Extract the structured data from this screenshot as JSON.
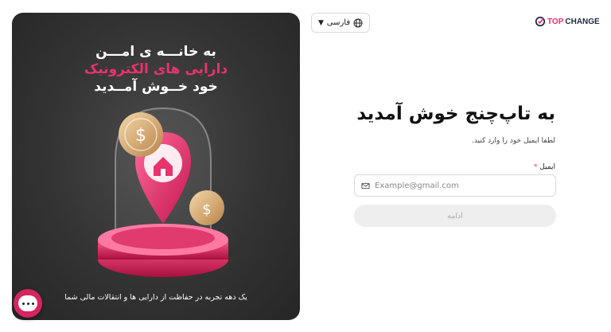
{
  "brand": {
    "logo_top": "TOP",
    "logo_change": "CHANGE",
    "accent_color": "#e8336d",
    "dark_color": "#1f2a44"
  },
  "language_selector": {
    "label": "فارسی",
    "icon": "globe-icon",
    "chevron": "chevron-down-icon"
  },
  "promo": {
    "line1": "به خانـــه ی امـــن",
    "line2": "دارایی های الکترونیک",
    "line3": "خود خــوش آمــدید",
    "caption": "یک دهه تجربه در حفاظت از دارایی ها و انتقالات مالی شما"
  },
  "form": {
    "title": "به تاپ‌چنج خوش آمدید",
    "subtitle": "لطفا ایمیل خود را وارد کنید.",
    "email_label": "ایمیل",
    "required_mark": "*",
    "email_placeholder": "Example@gmail.com",
    "email_value": "",
    "email_icon": "mail-icon",
    "continue_label": "ادامه"
  },
  "chat": {
    "icon": "chat-bubble-icon",
    "color": "#d6245f"
  }
}
